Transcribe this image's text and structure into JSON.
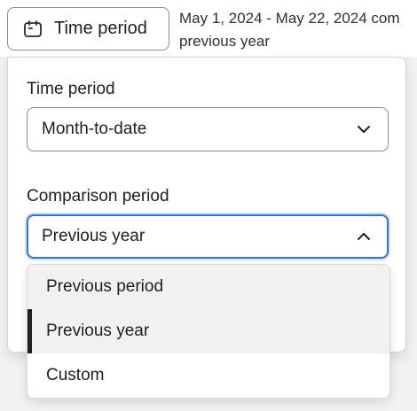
{
  "trigger": {
    "label": "Time period",
    "icon": "calendar-icon"
  },
  "summary": {
    "line1": "May 1, 2024 - May 22, 2024 com",
    "line2": "previous year"
  },
  "popover": {
    "time_period": {
      "label": "Time period",
      "value": "Month-to-date",
      "icon": "chevron-down-icon"
    },
    "comparison_period": {
      "label": "Comparison period",
      "value": "Previous year",
      "icon": "chevron-up-icon"
    }
  },
  "options": [
    {
      "label": "Previous period",
      "selected": false
    },
    {
      "label": "Previous year",
      "selected": true
    },
    {
      "label": "Custom",
      "selected": false
    }
  ],
  "colors": {
    "focus_border": "#2f76d6",
    "selected_indicator": "#202020",
    "option_highlight": "#f1f1f1"
  }
}
